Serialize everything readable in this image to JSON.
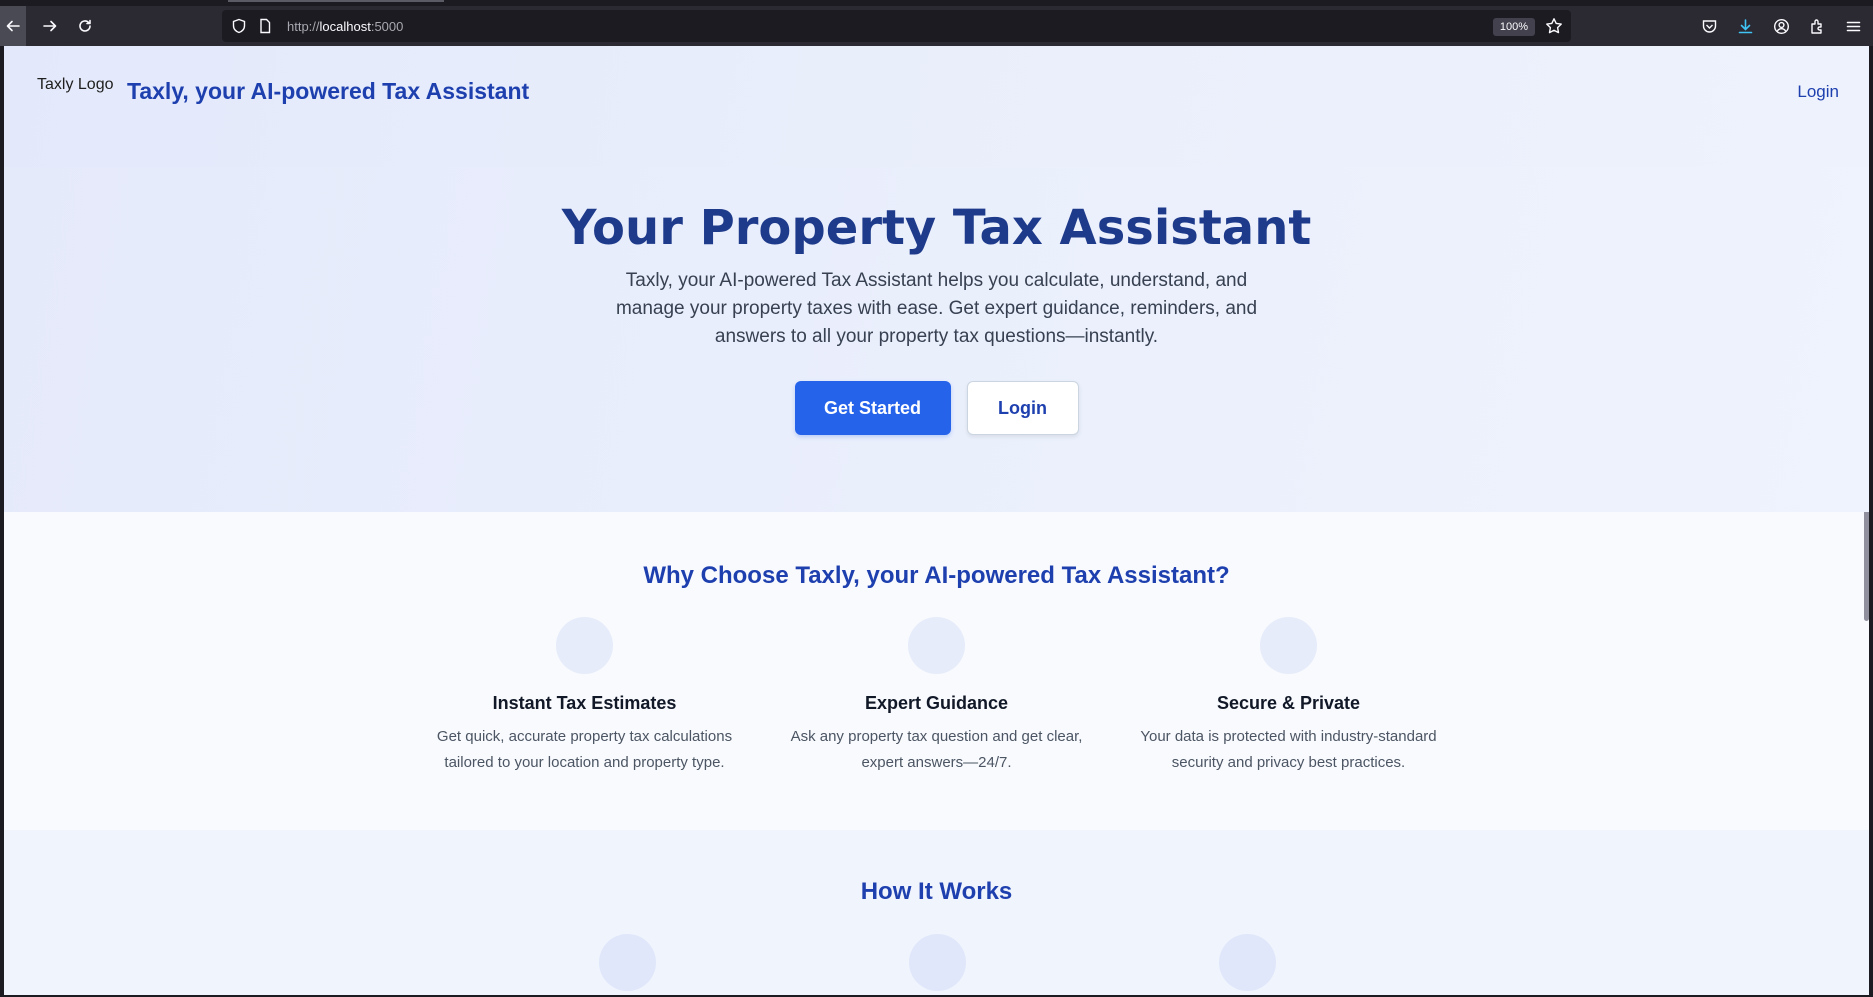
{
  "browser": {
    "url_protocol": "http://",
    "url_host": "localhost",
    "url_port": ":5000",
    "zoom": "100%"
  },
  "header": {
    "logo_alt": "Taxly Logo",
    "brand": "Taxly, your AI-powered Tax Assistant",
    "login": "Login"
  },
  "hero": {
    "title": "Your Property Tax Assistant",
    "description": "Taxly, your AI-powered Tax Assistant helps you calculate, understand, and manage your property taxes with ease. Get expert guidance, reminders, and answers to all your property tax questions—instantly.",
    "cta_primary": "Get Started",
    "cta_secondary": "Login"
  },
  "why": {
    "title": "Why Choose Taxly, your AI-powered Tax Assistant?",
    "features": [
      {
        "title": "Instant Tax Estimates",
        "description": "Get quick, accurate property tax calculations tailored to your location and property type."
      },
      {
        "title": "Expert Guidance",
        "description": "Ask any property tax question and get clear, expert answers—24/7."
      },
      {
        "title": "Secure & Private",
        "description": "Your data is protected with industry-standard security and privacy best practices."
      }
    ]
  },
  "how": {
    "title": "How It Works"
  },
  "colors": {
    "brand_blue": "#1e40af",
    "primary_button": "#2563eb",
    "hero_title": "#1e3a8a"
  }
}
